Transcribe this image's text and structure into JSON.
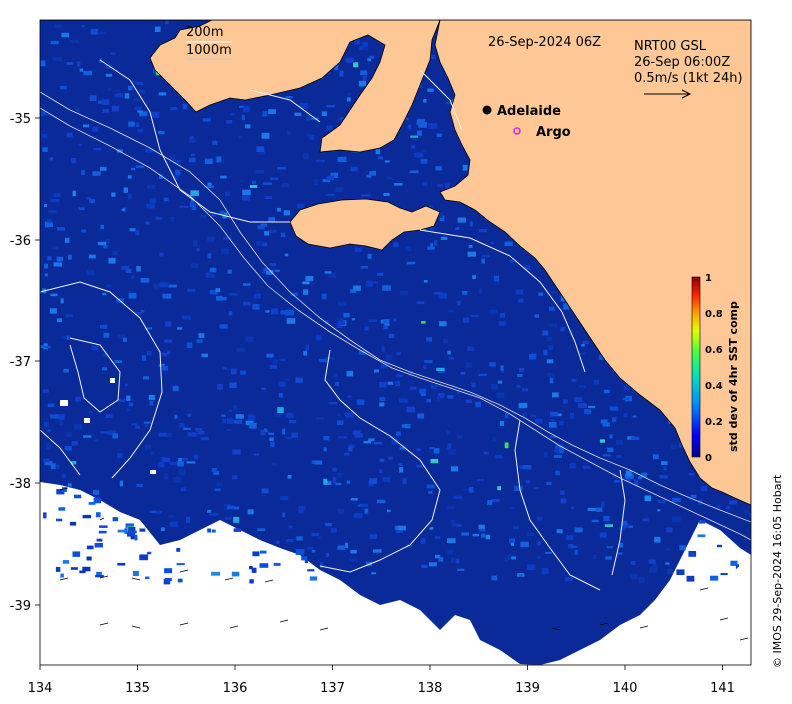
{
  "map": {
    "timestamp": "26-Sep-2024 06Z",
    "product": {
      "line1": "NRT00 GSL",
      "line2": "26-Sep 06:00Z",
      "scale_label": "0.5m/s (1kt 24h)"
    },
    "contours": {
      "label_200": "200m",
      "label_1000": "1000m"
    },
    "places": [
      {
        "name": "Adelaide",
        "marker": "filled-dot"
      },
      {
        "name": "Argo",
        "marker": "open-circle"
      }
    ],
    "x_ticks": [
      "134",
      "135",
      "136",
      "137",
      "138",
      "139",
      "140",
      "141"
    ],
    "y_ticks": [
      "-35",
      "-36",
      "-37",
      "-38",
      "-39"
    ],
    "colorbar": {
      "label": "std dev of 4hr SST comp",
      "ticks": [
        "1",
        "0.8",
        "0.6",
        "0.4",
        "0.2",
        "0"
      ]
    },
    "credit": "© IMOS 29-Sep-2024 16:05 Hobart",
    "colors": {
      "land": "#FDC896",
      "ocean_base": "#0a2a9a",
      "no_data": "#ffffff",
      "argo_marker": "#e020e0"
    }
  }
}
